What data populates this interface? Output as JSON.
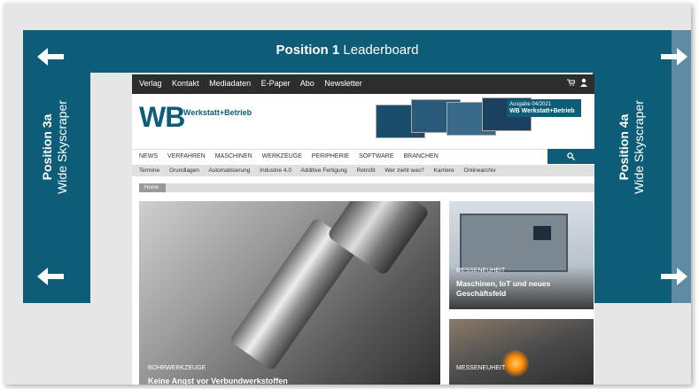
{
  "leaderboard": {
    "position_label": "Position 1",
    "name": "Leaderboard"
  },
  "skyscraper_left": {
    "position_label": "Position 3a",
    "name": "Wide Skyscraper"
  },
  "skyscraper_right": {
    "position_label": "Position 4a",
    "name": "Wide Skyscraper"
  },
  "colors": {
    "primary": "#0d5d78",
    "secondary": "#5f8ba4",
    "topbar": "#2d2d2d"
  },
  "site": {
    "topbar": {
      "items": [
        "Verlag",
        "Kontakt",
        "Mediadaten",
        "E-Paper",
        "Abo",
        "Newsletter"
      ],
      "icons": [
        "cart-icon",
        "user-icon"
      ]
    },
    "logo": {
      "mark": "WB",
      "name": "Werkstatt+Betrieb"
    },
    "issue_badge": {
      "line1": "Ausgabe 04/2021",
      "line2": "WB Werkstatt+Betrieb"
    },
    "mainnav": [
      "NEWS",
      "VERFAHREN",
      "MASCHINEN",
      "WERKZEUGE",
      "PERIPHERIE",
      "SOFTWARE",
      "BRANCHEN"
    ],
    "subnav": [
      "Termine",
      "Grundlagen",
      "Automatisierung",
      "Industrie 4.0",
      "Additive Fertigung",
      "Retrofit",
      "Wer zieht was?",
      "Karriere",
      "Onlinearchiv"
    ],
    "breadcrumb": "Home",
    "hero": {
      "kicker": "BOHRWERKZEUGE",
      "title": "Keine Angst vor Verbundwerkstoffen"
    },
    "card1": {
      "kicker": "MESSENEUHEIT",
      "title": "Maschinen, IoT und neues Geschäftsfeld"
    },
    "card2": {
      "kicker": "MESSENEUHEIT"
    }
  }
}
